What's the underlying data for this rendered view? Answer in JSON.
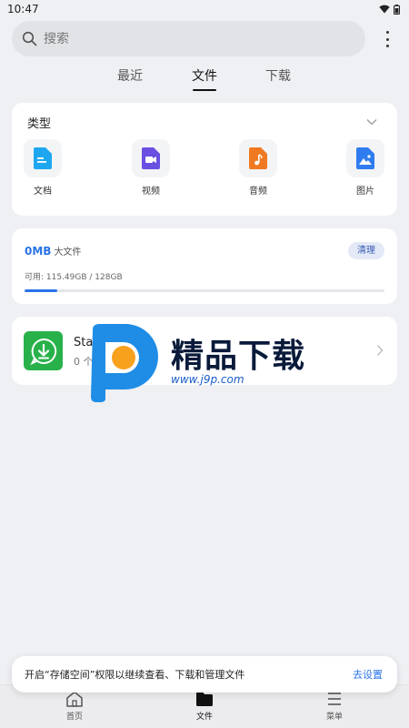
{
  "status_bar": {
    "time": "10:47"
  },
  "search": {
    "placeholder": "搜索"
  },
  "tabs": [
    {
      "label": "最近",
      "active": false
    },
    {
      "label": "文件",
      "active": true
    },
    {
      "label": "下载",
      "active": false
    }
  ],
  "type_section": {
    "title": "类型",
    "items": [
      {
        "label": "文档",
        "icon": "document-icon",
        "color": "#1ea7f0"
      },
      {
        "label": "视频",
        "icon": "video-icon",
        "color": "#6a4fe0"
      },
      {
        "label": "音频",
        "icon": "audio-icon",
        "color": "#f07a22"
      },
      {
        "label": "图片",
        "icon": "image-icon",
        "color": "#2f7cf0"
      }
    ]
  },
  "storage": {
    "size": "0MB",
    "kind": "大文件",
    "clean_label": "清理",
    "available_text": "可用: 115.49GB / 128GB",
    "used_fraction": 0.09,
    "accent_color": "#2a73e8"
  },
  "app_entry": {
    "name": "Status Saver",
    "count_text": "0 个文件",
    "icon": "whatsapp-download-icon",
    "icon_color": "#28b14a"
  },
  "watermark": {
    "title": "精品下载",
    "url": "www.j9p.com"
  },
  "snackbar": {
    "message": "开启“存储空间”权限以继续查看、下载和管理文件",
    "action": "去设置"
  },
  "bottom_nav": [
    {
      "label": "首页",
      "icon": "home-icon",
      "active": false
    },
    {
      "label": "文件",
      "icon": "folder-icon",
      "active": true
    },
    {
      "label": "菜单",
      "icon": "menu-icon",
      "active": false
    }
  ]
}
